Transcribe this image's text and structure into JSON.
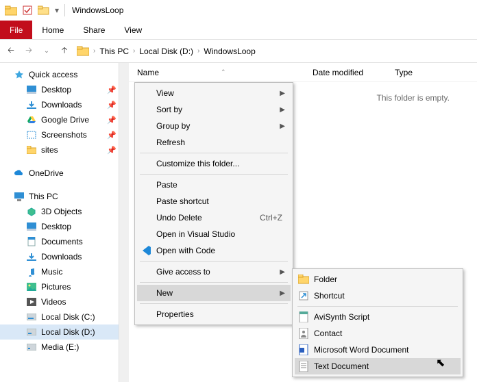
{
  "titlebar": {
    "title": "WindowsLoop"
  },
  "ribbon": {
    "file": "File",
    "home": "Home",
    "share": "Share",
    "view": "View"
  },
  "breadcrumb": {
    "root": "This PC",
    "drive": "Local Disk (D:)",
    "folder": "WindowsLoop"
  },
  "headers": {
    "name": "Name",
    "date": "Date modified",
    "type": "Type"
  },
  "empty_text": "This folder is empty.",
  "sidebar": {
    "quick": "Quick access",
    "qitems": [
      {
        "label": "Desktop"
      },
      {
        "label": "Downloads"
      },
      {
        "label": "Google Drive"
      },
      {
        "label": "Screenshots"
      },
      {
        "label": "sites"
      }
    ],
    "onedrive": "OneDrive",
    "thispc": "This PC",
    "pcitems": [
      {
        "label": "3D Objects"
      },
      {
        "label": "Desktop"
      },
      {
        "label": "Documents"
      },
      {
        "label": "Downloads"
      },
      {
        "label": "Music"
      },
      {
        "label": "Pictures"
      },
      {
        "label": "Videos"
      },
      {
        "label": "Local Disk (C:)"
      },
      {
        "label": "Local Disk (D:)"
      },
      {
        "label": "Media (E:)"
      }
    ]
  },
  "ctx": {
    "view": "View",
    "sort": "Sort by",
    "group": "Group by",
    "refresh": "Refresh",
    "customize": "Customize this folder...",
    "paste": "Paste",
    "paste_sc": "Paste shortcut",
    "undo": "Undo Delete",
    "undo_key": "Ctrl+Z",
    "open_vs": "Open in Visual Studio",
    "open_code": "Open with Code",
    "give": "Give access to",
    "new": "New",
    "props": "Properties"
  },
  "newmenu": {
    "folder": "Folder",
    "shortcut": "Shortcut",
    "avisynth": "AviSynth Script",
    "contact": "Contact",
    "word": "Microsoft Word Document",
    "text": "Text Document"
  }
}
